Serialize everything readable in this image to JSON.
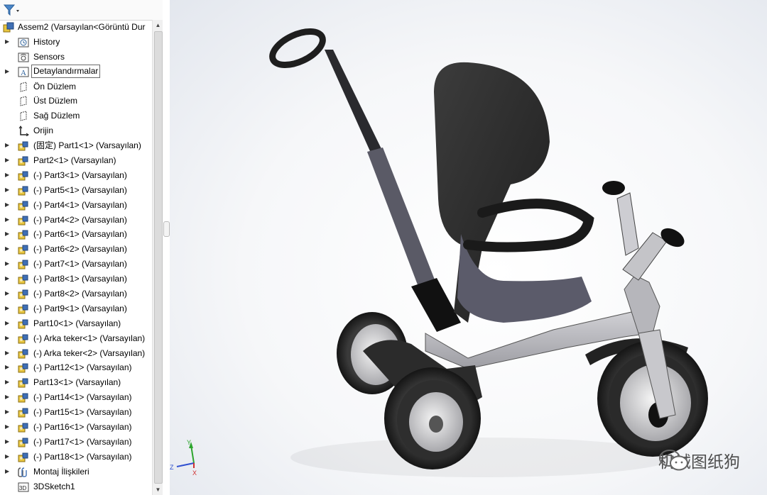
{
  "filter_icon": "funnel-icon",
  "tree": {
    "root": {
      "label": "Assem2  (Varsayılan<Görüntü Dur",
      "icon": "assembly-icon"
    },
    "items": [
      {
        "label": "History",
        "icon": "history-folder-icon",
        "expand": true
      },
      {
        "label": "Sensors",
        "icon": "sensor-icon",
        "expand": false
      },
      {
        "label": "Detaylandırmalar",
        "icon": "annotations-icon",
        "expand": true,
        "selected": true
      },
      {
        "label": "Ön Düzlem",
        "icon": "plane-icon",
        "expand": false
      },
      {
        "label": "Üst Düzlem",
        "icon": "plane-icon",
        "expand": false
      },
      {
        "label": "Sağ Düzlem",
        "icon": "plane-icon",
        "expand": false
      },
      {
        "label": "Orijin",
        "icon": "origin-icon",
        "expand": false
      },
      {
        "label": "(固定) Part1<1> (Varsayılan)",
        "icon": "part-icon",
        "expand": true
      },
      {
        "label": "Part2<1> (Varsayılan)",
        "icon": "part-icon",
        "expand": true
      },
      {
        "label": "(-) Part3<1> (Varsayılan)",
        "icon": "part-icon",
        "expand": true
      },
      {
        "label": "(-) Part5<1> (Varsayılan)",
        "icon": "part-icon",
        "expand": true
      },
      {
        "label": "(-) Part4<1> (Varsayılan)",
        "icon": "part-icon",
        "expand": true
      },
      {
        "label": "(-) Part4<2> (Varsayılan)",
        "icon": "part-icon",
        "expand": true
      },
      {
        "label": "(-) Part6<1> (Varsayılan)",
        "icon": "part-icon",
        "expand": true
      },
      {
        "label": "(-) Part6<2> (Varsayılan)",
        "icon": "part-icon",
        "expand": true
      },
      {
        "label": "(-) Part7<1> (Varsayılan)",
        "icon": "part-icon",
        "expand": true
      },
      {
        "label": "(-) Part8<1> (Varsayılan)",
        "icon": "part-icon",
        "expand": true
      },
      {
        "label": "(-) Part8<2> (Varsayılan)",
        "icon": "part-icon",
        "expand": true
      },
      {
        "label": "(-) Part9<1> (Varsayılan)",
        "icon": "part-icon",
        "expand": true
      },
      {
        "label": "Part10<1> (Varsayılan)",
        "icon": "part-icon",
        "expand": true
      },
      {
        "label": "(-) Arka teker<1> (Varsayılan)",
        "icon": "part-icon",
        "expand": true
      },
      {
        "label": "(-) Arka teker<2> (Varsayılan)",
        "icon": "part-icon",
        "expand": true
      },
      {
        "label": "(-) Part12<1> (Varsayılan)",
        "icon": "part-icon",
        "expand": true
      },
      {
        "label": "Part13<1> (Varsayılan)",
        "icon": "part-icon",
        "expand": true
      },
      {
        "label": "(-) Part14<1> (Varsayılan)",
        "icon": "part-icon",
        "expand": true
      },
      {
        "label": "(-) Part15<1> (Varsayılan)",
        "icon": "part-icon",
        "expand": true
      },
      {
        "label": "(-) Part16<1> (Varsayılan)",
        "icon": "part-icon",
        "expand": true
      },
      {
        "label": "(-) Part17<1> (Varsayılan)",
        "icon": "part-icon",
        "expand": true
      },
      {
        "label": "(-) Part18<1> (Varsayılan)",
        "icon": "part-icon",
        "expand": true
      },
      {
        "label": "Montaj İlişkileri",
        "icon": "mates-icon",
        "expand": true
      },
      {
        "label": "3DSketch1",
        "icon": "sketch3d-icon",
        "expand": false
      }
    ]
  },
  "triad": {
    "x": "X",
    "y": "Y",
    "z": "Z"
  },
  "watermark": {
    "text": "机械图纸狗",
    "icon": "wechat-icon"
  },
  "colors": {
    "part_yellow": "#e8c640",
    "part_blue": "#3f6fb5",
    "body_dark": "#2b2b2b",
    "frame_grey": "#c9c9cc",
    "background": "#eef1f5"
  }
}
